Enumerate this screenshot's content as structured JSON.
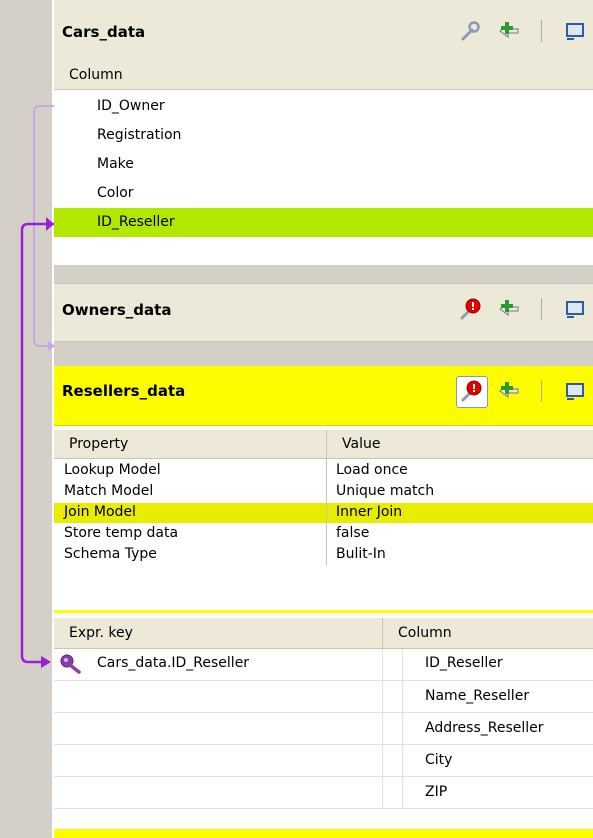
{
  "cars": {
    "title": "Cars_data",
    "column_header": "Column",
    "columns": [
      "ID_Owner",
      "Registration",
      "Make",
      "Color",
      "ID_Reseller"
    ]
  },
  "owners": {
    "title": "Owners_data"
  },
  "resellers": {
    "title": "Resellers_data",
    "property_header": "Property",
    "value_header": "Value",
    "properties": [
      {
        "name": "Lookup Model",
        "value": "Load once"
      },
      {
        "name": "Match Model",
        "value": "Unique match"
      },
      {
        "name": "Join Model",
        "value": "Inner Join"
      },
      {
        "name": "Store temp data",
        "value": "false"
      },
      {
        "name": "Schema Type",
        "value": "Bulit-In"
      }
    ],
    "expr_header": "Expr. key",
    "column_header": "Column",
    "expr_key": "Cars_data.ID_Reseller",
    "columns": [
      "ID_Reseller",
      "Name_Reseller",
      "Address_Reseller",
      "City",
      "ZIP"
    ]
  },
  "colors": {
    "selected_green": "#b2e800",
    "selected_yellow": "#e8ec00",
    "title_yellow": "#fdfd00",
    "link_purple": "#9b1fd6",
    "link_light": "#c9a7e6"
  },
  "icons": [
    "wrench-icon",
    "add-output-icon",
    "minimize-icon",
    "error-filter-icon",
    "key-icon"
  ]
}
